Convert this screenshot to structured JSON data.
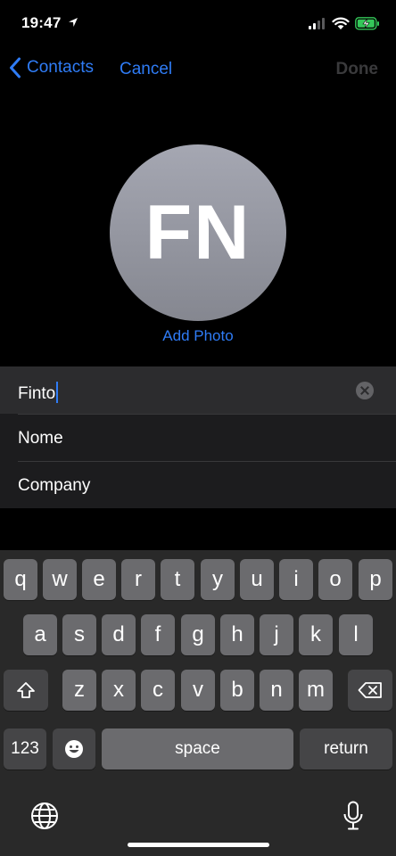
{
  "status_bar": {
    "time": "19:47"
  },
  "nav": {
    "back_label": "Contacts",
    "cancel_label": "Cancel",
    "done_label": "Done"
  },
  "avatar": {
    "initials": "FN",
    "add_photo_label": "Add Photo"
  },
  "form": {
    "first_name_value": "Finto",
    "last_name_placeholder": "Nome",
    "company_placeholder": "Company"
  },
  "keyboard": {
    "row1": [
      "q",
      "w",
      "e",
      "r",
      "t",
      "y",
      "u",
      "i",
      "o",
      "p"
    ],
    "row2": [
      "a",
      "s",
      "d",
      "f",
      "g",
      "h",
      "j",
      "k",
      "l"
    ],
    "row3": [
      "z",
      "x",
      "c",
      "v",
      "b",
      "n",
      "m"
    ],
    "numbers_label": "123",
    "space_label": "space",
    "return_label": "return"
  },
  "colors": {
    "accent": "#2f7cf6",
    "battery": "#34c759",
    "background": "#000000",
    "key": "#6b6b6e",
    "key_dark": "#454547"
  }
}
